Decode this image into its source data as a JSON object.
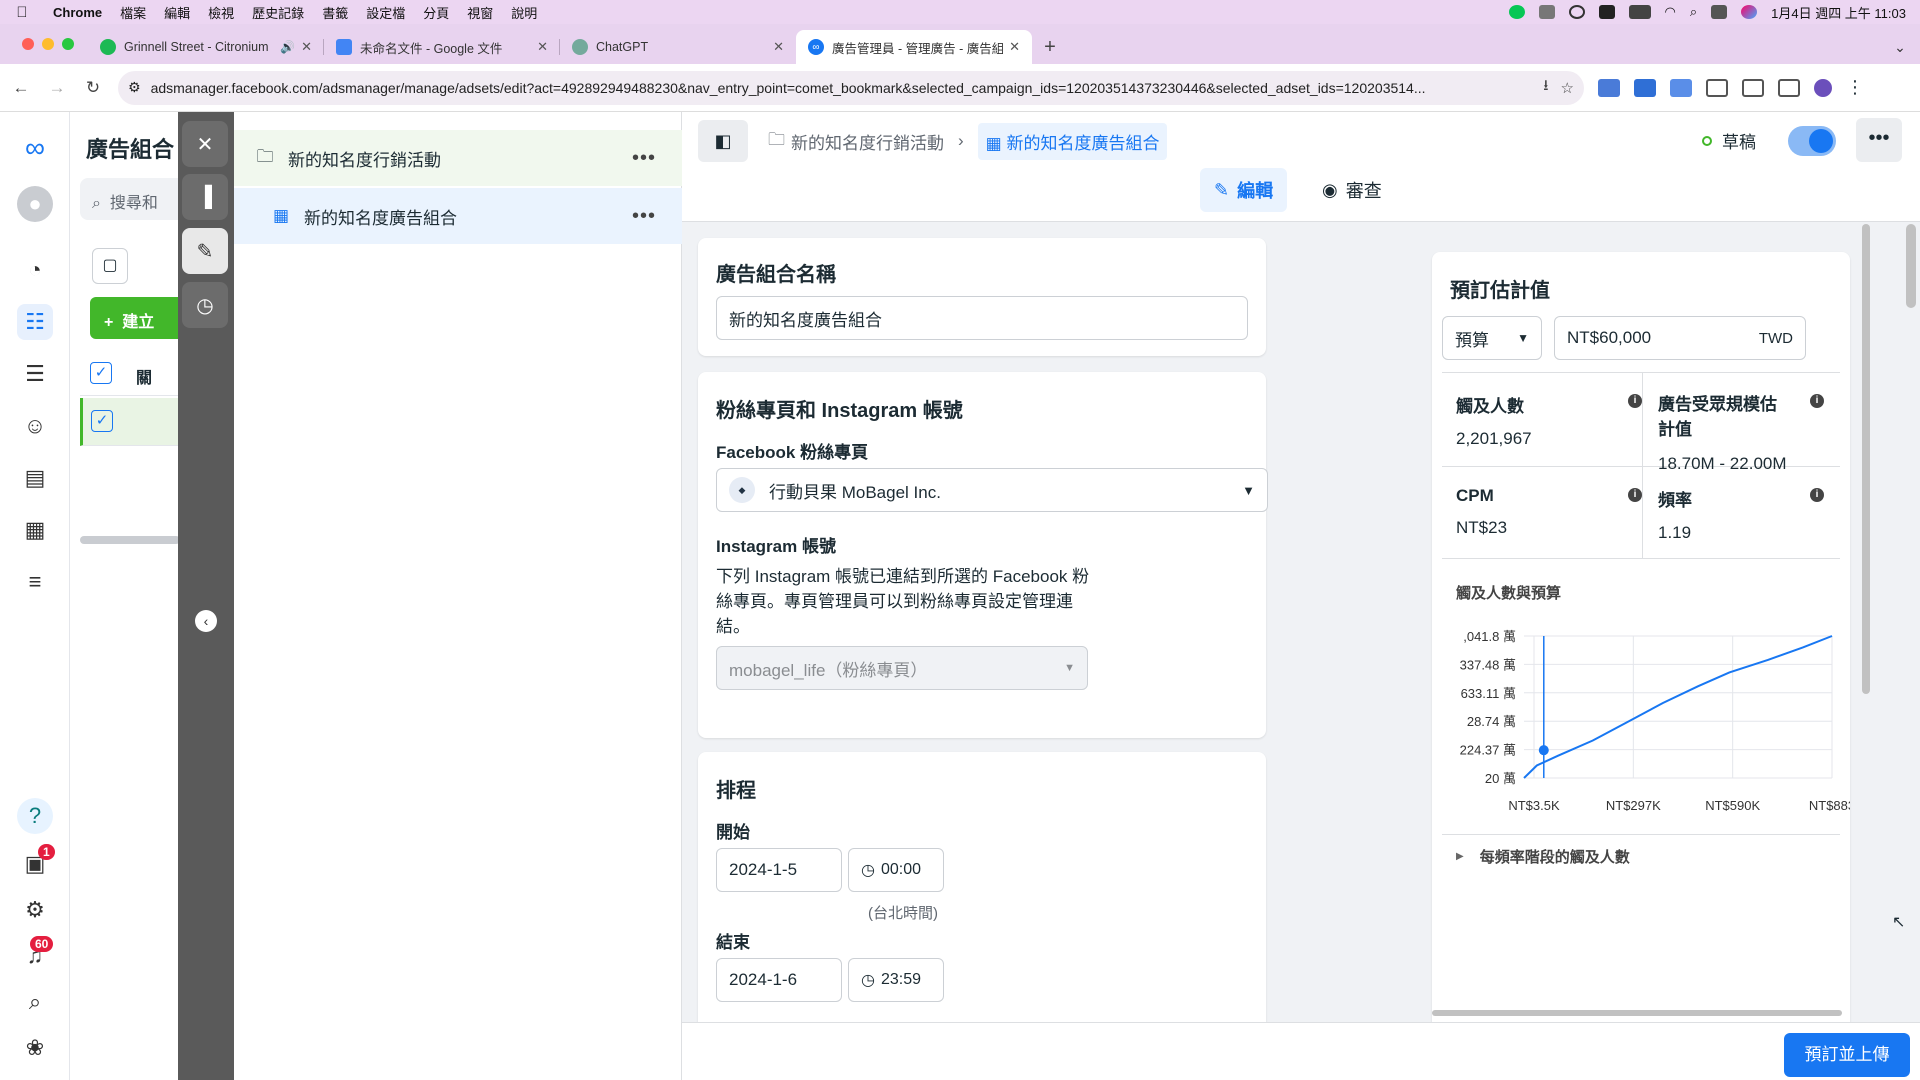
{
  "menubar": {
    "items": [
      "Chrome",
      "檔案",
      "編輯",
      "檢視",
      "歷史記錄",
      "書籤",
      "設定檔",
      "分頁",
      "視窗",
      "說明"
    ],
    "clock": "1月4日 週四 上午 11:03"
  },
  "tabs": [
    {
      "label": "Grinnell Street - Citronium",
      "icon": "spotify-icon",
      "color": "#1db954"
    },
    {
      "label": "未命名文件 - Google 文件",
      "icon": "google-docs-icon",
      "color": "#4285f4"
    },
    {
      "label": "ChatGPT",
      "icon": "chatgpt-icon",
      "color": "#74aa9c"
    },
    {
      "label": "廣告管理員 - 管理廣告 - 廣告組合",
      "icon": "meta-icon",
      "color": "#1877f2"
    }
  ],
  "address": {
    "url": "adsmanager.facebook.com/adsmanager/manage/adsets/edit?act=492892949488230&nav_entry_point=comet_bookmark&selected_campaign_ids=120203514373230446&selected_adset_ids=120203514..."
  },
  "rail": {
    "notifications_badge": "1",
    "alerts_badge": "60"
  },
  "tree_bg": {
    "title": "廣告組合",
    "search_placeholder": "搜尋和",
    "create_label": "建立",
    "col_header": "關"
  },
  "tree": {
    "campaign": "新的知名度行銷活動",
    "adset": "新的知名度廣告組合"
  },
  "header": {
    "crumb_campaign": "新的知名度行銷活動",
    "crumb_adset": "新的知名度廣告組合",
    "status": "草稿",
    "tab_edit": "編輯",
    "tab_review": "審查"
  },
  "adset_name": {
    "title": "廣告組合名稱",
    "value": "新的知名度廣告組合"
  },
  "identity": {
    "title": "粉絲專頁和 Instagram 帳號",
    "fb_label": "Facebook 粉絲專頁",
    "fb_value": "行動貝果 MoBagel Inc.",
    "ig_label": "Instagram 帳號",
    "ig_desc": "下列 Instagram 帳號已連結到所選的 Facebook 粉絲專頁。專頁管理員可以到粉絲專頁設定管理連結。",
    "ig_value": "mobagel_life（粉絲專頁）"
  },
  "schedule": {
    "title": "排程",
    "start_label": "開始",
    "start_date": "2024-1-5",
    "start_time": "00:00",
    "timezone": "(台北時間)",
    "end_label": "結束",
    "end_date": "2024-1-6",
    "end_time": "23:59"
  },
  "estimates": {
    "title": "預訂估計值",
    "budget_type": "預算",
    "budget_value": "NT$60,000",
    "currency": "TWD",
    "reach_label": "觸及人數",
    "reach_value": "2,201,967",
    "audience_label": "廣告受眾規模估計值",
    "audience_value": "18.70M - 22.00M",
    "cpm_label": "CPM",
    "cpm_value": "NT$23",
    "freq_label": "頻率",
    "freq_value": "1.19",
    "chart_title": "觸及人數與預算",
    "freq_breakdown": "每頻率階段的觸及人數"
  },
  "chart_data": {
    "type": "line",
    "title": "觸及人數與預算",
    "y_tick_labels": [
      ",041.8 萬",
      "337.48 萬",
      "633.11 萬",
      "28.74 萬",
      "224.37 萬",
      "20 萬"
    ],
    "x_tick_labels": [
      "NT$3.5K",
      "NT$297K",
      "NT$590K",
      "NT$883"
    ],
    "x_thousands": [
      3.5,
      40,
      100,
      200,
      297,
      400,
      500,
      590,
      700,
      800,
      883
    ],
    "y_wan": [
      20,
      110,
      180,
      290,
      420,
      560,
      680,
      780,
      870,
      960,
      1041.8
    ],
    "selected_point": {
      "x_thousands": 60,
      "y_wan": 220.1967
    },
    "xlim": [
      3.5,
      883
    ],
    "ylim": [
      20,
      1041.8
    ],
    "color": "#1877f2"
  },
  "footer": {
    "publish_label": "預訂並上傳"
  }
}
